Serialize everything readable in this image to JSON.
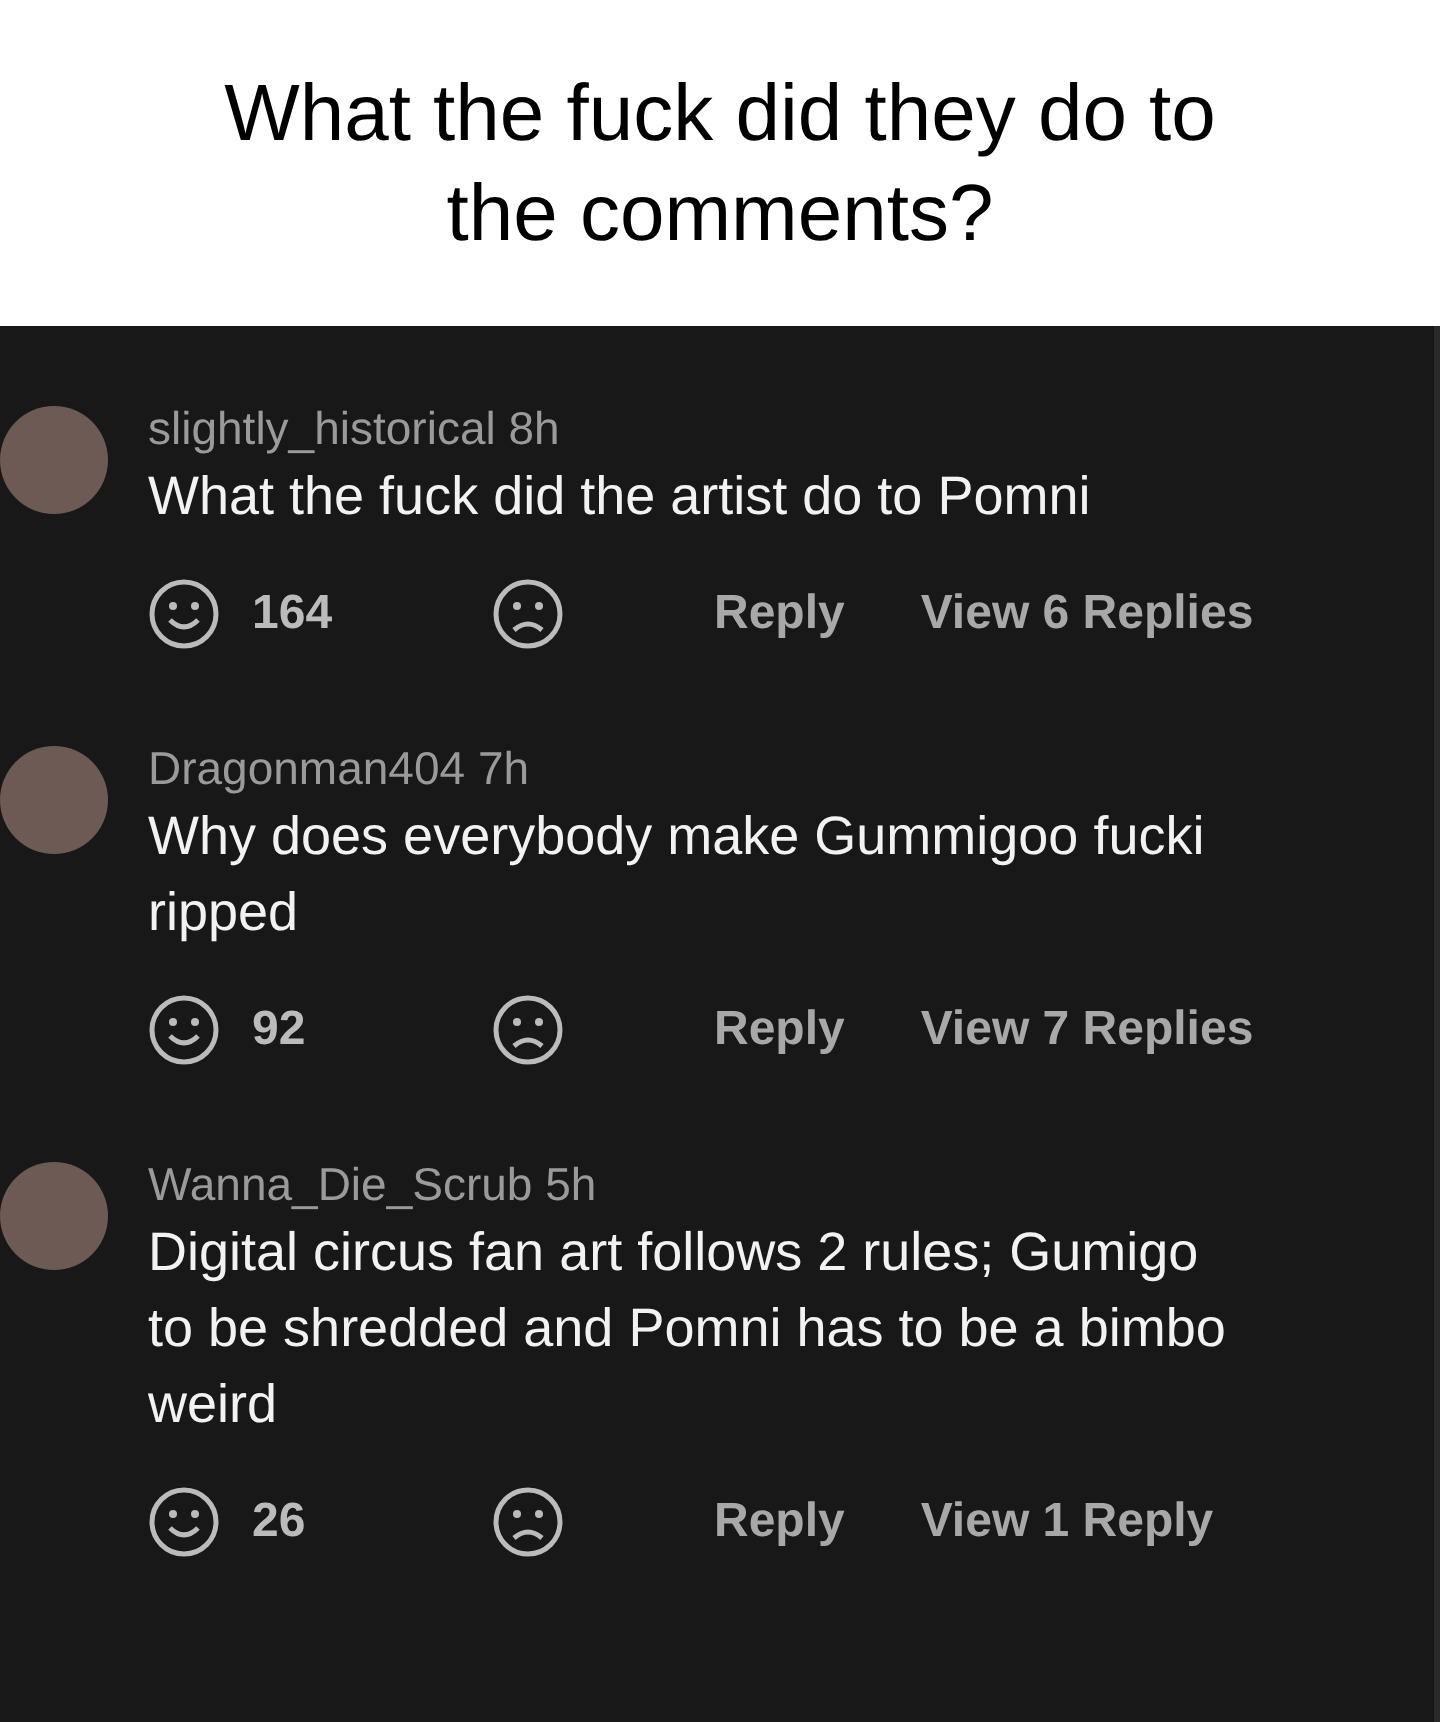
{
  "caption": [
    "What the fuck did they do to",
    "the comments?"
  ],
  "comments": [
    {
      "user": "slightly_historical",
      "time": "8h",
      "lines": [
        "What the fuck did the artist do to Pomni"
      ],
      "likes": "164",
      "reply": "Reply",
      "view": "View 6 Replies"
    },
    {
      "user": "Dragonman404",
      "time": "7h",
      "lines": [
        "Why does everybody make Gummigoo fucki",
        "ripped"
      ],
      "likes": "92",
      "reply": "Reply",
      "view": "View 7 Replies"
    },
    {
      "user": "Wanna_Die_Scrub",
      "time": "5h",
      "lines": [
        "Digital circus fan art follows 2 rules; Gumigo",
        "to be shredded and Pomni has to be a bimbo",
        "weird"
      ],
      "likes": "26",
      "reply": "Reply",
      "view": "View 1 Reply"
    }
  ]
}
